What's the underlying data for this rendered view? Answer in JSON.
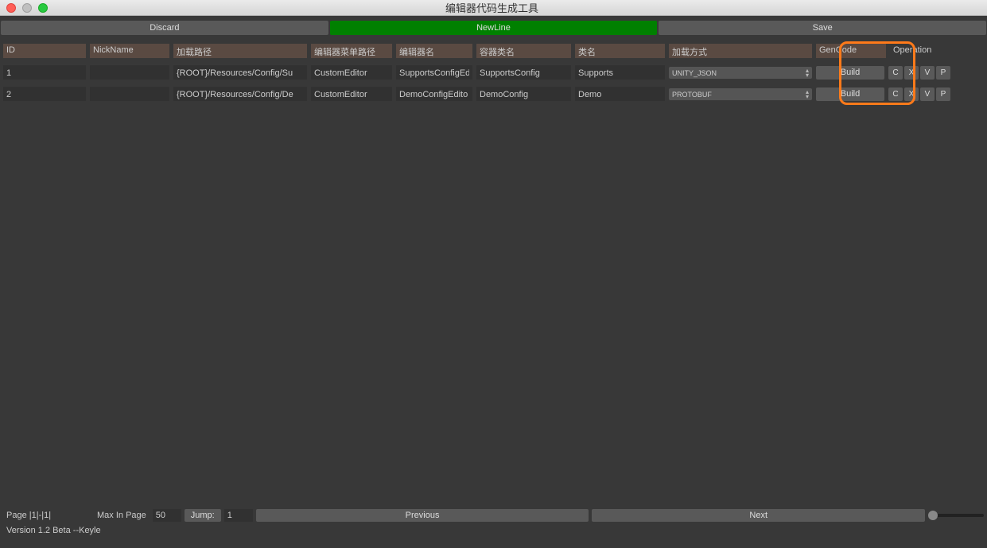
{
  "window": {
    "title": "编辑器代码生成工具"
  },
  "toolbar": {
    "discard": "Discard",
    "newline": "NewLine",
    "save": "Save"
  },
  "headers": {
    "id": "ID",
    "nickname": "NickName",
    "loadpath": "加载路径",
    "menupath": "编辑器菜单路径",
    "editorname": "编辑器名",
    "container": "容器类名",
    "classname": "类名",
    "loadtype": "加载方式",
    "gencode": "GenCode",
    "operation": "Operation"
  },
  "rows": [
    {
      "id": "1",
      "nickname": "",
      "loadpath": "{ROOT}/Resources/Config/Su",
      "menupath": "CustomEditor",
      "editorname": "SupportsConfigEd",
      "container": "SupportsConfig",
      "classname": "Supports",
      "loadtype": "UNITY_JSON",
      "build": "Build",
      "op_c": "C",
      "op_x": "X",
      "op_v": "V",
      "op_p": "P"
    },
    {
      "id": "2",
      "nickname": "",
      "loadpath": "{ROOT}/Resources/Config/De",
      "menupath": "CustomEditor",
      "editorname": "DemoConfigEdito",
      "container": "DemoConfig",
      "classname": "Demo",
      "loadtype": "PROTOBUF",
      "build": "Build",
      "op_c": "C",
      "op_x": "X",
      "op_v": "V",
      "op_p": "P"
    }
  ],
  "footer": {
    "page_label": "Page |1|-|1|",
    "max_label": "Max In Page",
    "max_value": "50",
    "jump_label": "Jump:",
    "jump_value": "1",
    "previous": "Previous",
    "next": "Next",
    "version": "Version 1.2 Beta   --Keyle"
  }
}
